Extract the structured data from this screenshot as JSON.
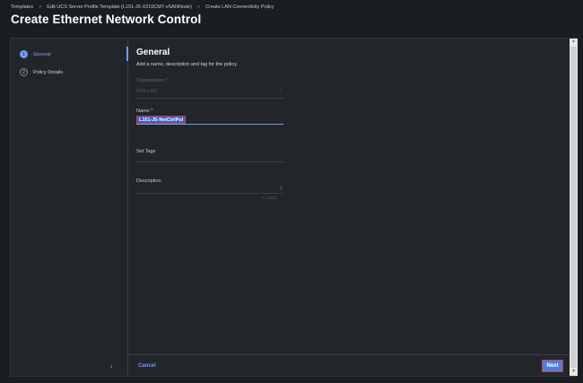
{
  "breadcrumb": {
    "items": [
      "Templates",
      "Edit UCS Server Profile Template (L151-J5-X210CM7-vSANNode)",
      "Create LAN Connectivity Policy"
    ],
    "separator": ">"
  },
  "page_title": "Create Ethernet Network Control",
  "steps": [
    {
      "number": "1",
      "label": "General",
      "active": true
    },
    {
      "number": "2",
      "label": "Policy Details",
      "active": false
    }
  ],
  "form": {
    "title": "General",
    "subtitle": "Add a name, description and tag for the policy.",
    "organization": {
      "label": "Organization *",
      "value": "UCS-L151"
    },
    "name": {
      "label": "Name *",
      "value": "L151-J5-NetCtrlPol"
    },
    "tags": {
      "label": "Set Tags"
    },
    "description": {
      "label": "Description",
      "counter": "<= 1024"
    }
  },
  "footer": {
    "cancel_label": "Cancel",
    "next_label": "Next"
  },
  "icons": {
    "collapse": "chevron-left-icon",
    "org_dropdown": "chevron-down-icon"
  },
  "colors": {
    "accent": "#6f9df2",
    "highlight_border": "#e0383b",
    "background": "#1a1d21"
  }
}
